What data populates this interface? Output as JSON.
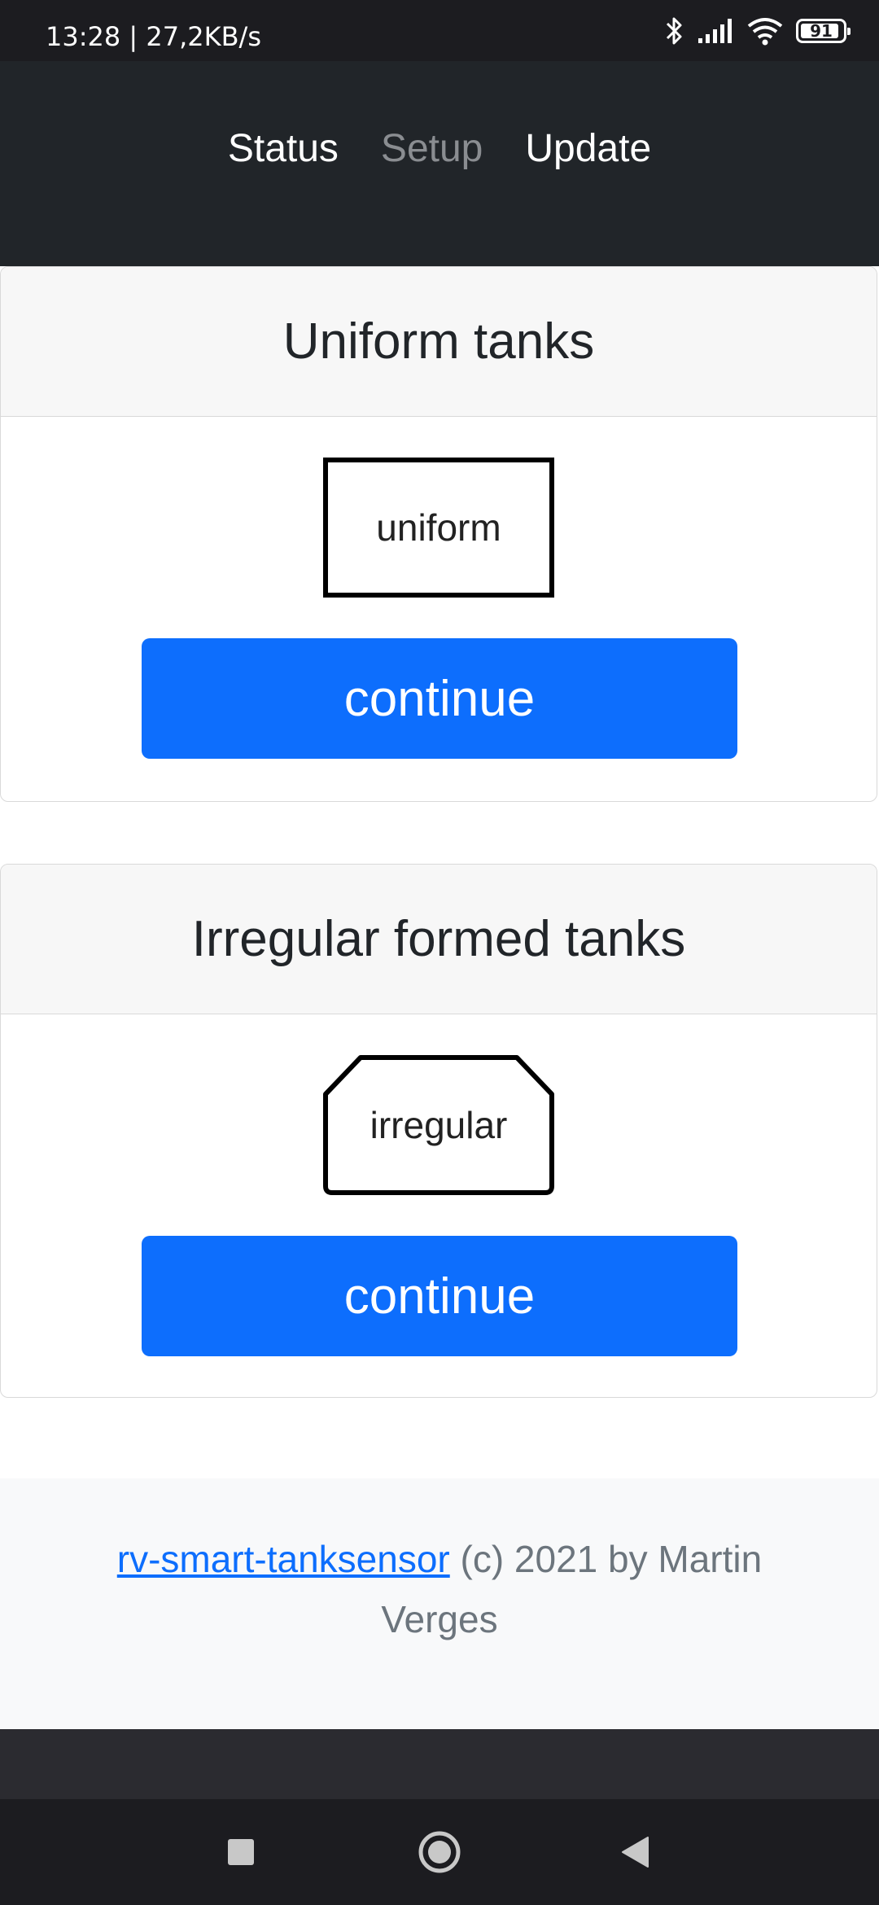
{
  "status_bar": {
    "time_speed": "13:28 | 27,2KB/s",
    "battery": "91",
    "battery_level": 0.91,
    "icons": [
      "bluetooth-icon",
      "signal-icon",
      "wifi-icon",
      "battery-icon"
    ]
  },
  "nav": {
    "items": [
      {
        "label": "Status",
        "active": false
      },
      {
        "label": "Setup",
        "active": true
      },
      {
        "label": "Update",
        "active": false
      }
    ]
  },
  "cards": [
    {
      "title": "Uniform tanks",
      "shape_label": "uniform",
      "button_label": "continue"
    },
    {
      "title": "Irregular formed tanks",
      "shape_label": "irregular",
      "button_label": "continue"
    }
  ],
  "footer": {
    "link_text": "rv-smart-tanksensor",
    "text": " (c) 2021 by Martin Verges"
  },
  "colors": {
    "primary": "#0d6efd",
    "navbar": "#212529",
    "statusbar": "#1c1c20"
  },
  "system_nav": [
    "recents-square-icon",
    "home-circle-icon",
    "back-triangle-icon"
  ]
}
